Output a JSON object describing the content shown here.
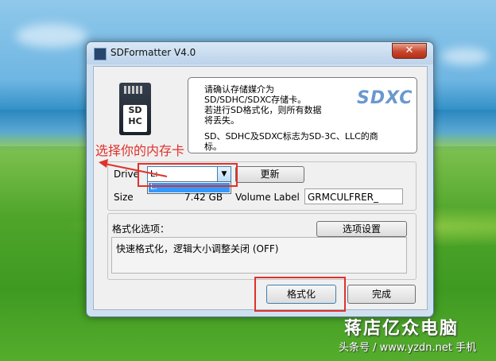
{
  "window": {
    "title": "SDFormatter V4.0",
    "close": "✕"
  },
  "card_icon": {
    "text": "SD HC"
  },
  "info": {
    "line1": "请确认存储媒介为\nSD/SDHC/SDXC存储卡。\n若进行SD格式化，则所有数据\n将丢失。",
    "line2": "SD、SDHC及SDXC标志为SD-3C、LLC的商\n标。",
    "logo": "SDXC"
  },
  "drive": {
    "label": "Drive",
    "value": "L:",
    "dropdown_option": "L:",
    "refresh_label": "更新"
  },
  "size": {
    "label": "Size",
    "value": "7.42 GB"
  },
  "volume": {
    "label": "Volume Label",
    "value": "GRMCULFRER_"
  },
  "format_options": {
    "heading": "格式化选项：",
    "settings_label": "选项设置",
    "summary": "快速格式化，逻辑大小调整关闭 (OFF)"
  },
  "actions": {
    "format_label": "格式化",
    "finish_label": "完成"
  },
  "annotation": {
    "text": "选择你的内存卡"
  },
  "watermark": {
    "brand": "蒋店亿众电脑",
    "url": "头条号 / www.yzdn.net 手机"
  },
  "colors": {
    "annotation": "#e0312b",
    "selection": "#3399ff"
  }
}
